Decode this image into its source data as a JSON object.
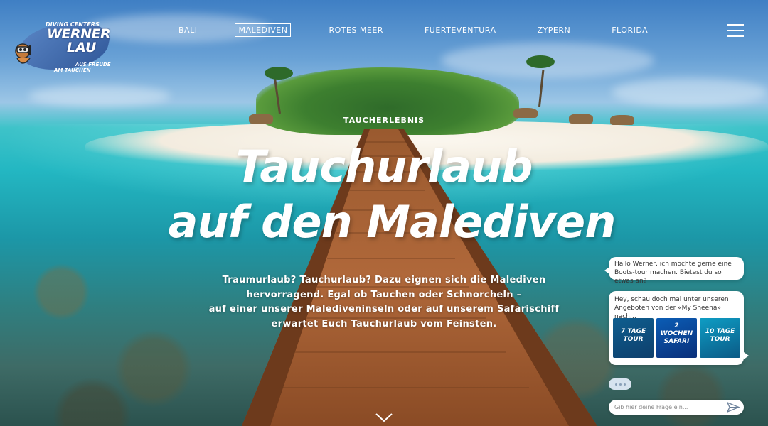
{
  "logo": {
    "diving_centers": "DIVING CENTERS",
    "werner": "WERNER",
    "lau": "LAU",
    "tagline_1": "AUS FREUDE",
    "tagline_2": "AM TAUCHEN"
  },
  "nav": {
    "items": [
      {
        "label": "BALI",
        "active": false
      },
      {
        "label": "MALEDIVEN",
        "active": true
      },
      {
        "label": "ROTES MEER",
        "active": false
      },
      {
        "label": "FUERTEVENTURA",
        "active": false
      },
      {
        "label": "ZYPERN",
        "active": false
      },
      {
        "label": "FLORIDA",
        "active": false
      }
    ],
    "menu_icon": "hamburger-icon"
  },
  "hero": {
    "eyebrow": "TAUCHERLEBNIS",
    "headline_line1": "Tauchurlaub",
    "headline_line2": "auf den Malediven",
    "intro_lines": [
      "Traumurlaub? Tauchurlaub? Dazu eignen sich die Malediven",
      "hervorragend. Egal ob Tauchen oder Schnorcheln –",
      "auf einer unserer Malediveninseln oder auf unserem Safarischiff",
      "erwartet Euch Tauchurlaub vom Feinsten."
    ],
    "scroll_icon": "chevron-down-icon"
  },
  "chat": {
    "user_message": "Hallo Werner, ich möchte gerne eine Boots-tour machen. Bietest du so etwas an?",
    "bot_message": "Hey, schau doch mal unter unseren Angeboten von der «My Sheena» nach…",
    "cards": [
      {
        "line1": "7 TAGE",
        "line2": "TOUR"
      },
      {
        "line1": "2",
        "line2": "WOCHEN",
        "line3": "SAFARI"
      },
      {
        "line1": "10 TAGE",
        "line2": "TOUR"
      }
    ],
    "typing_indicator": "…",
    "input_placeholder": "Gib hier deine Frage ein...",
    "send_icon": "send-icon"
  },
  "colors": {
    "sky": "#6aa2d6",
    "lagoon": "#23b7c2",
    "jetty": "#a05a2e",
    "white": "#ffffff"
  }
}
